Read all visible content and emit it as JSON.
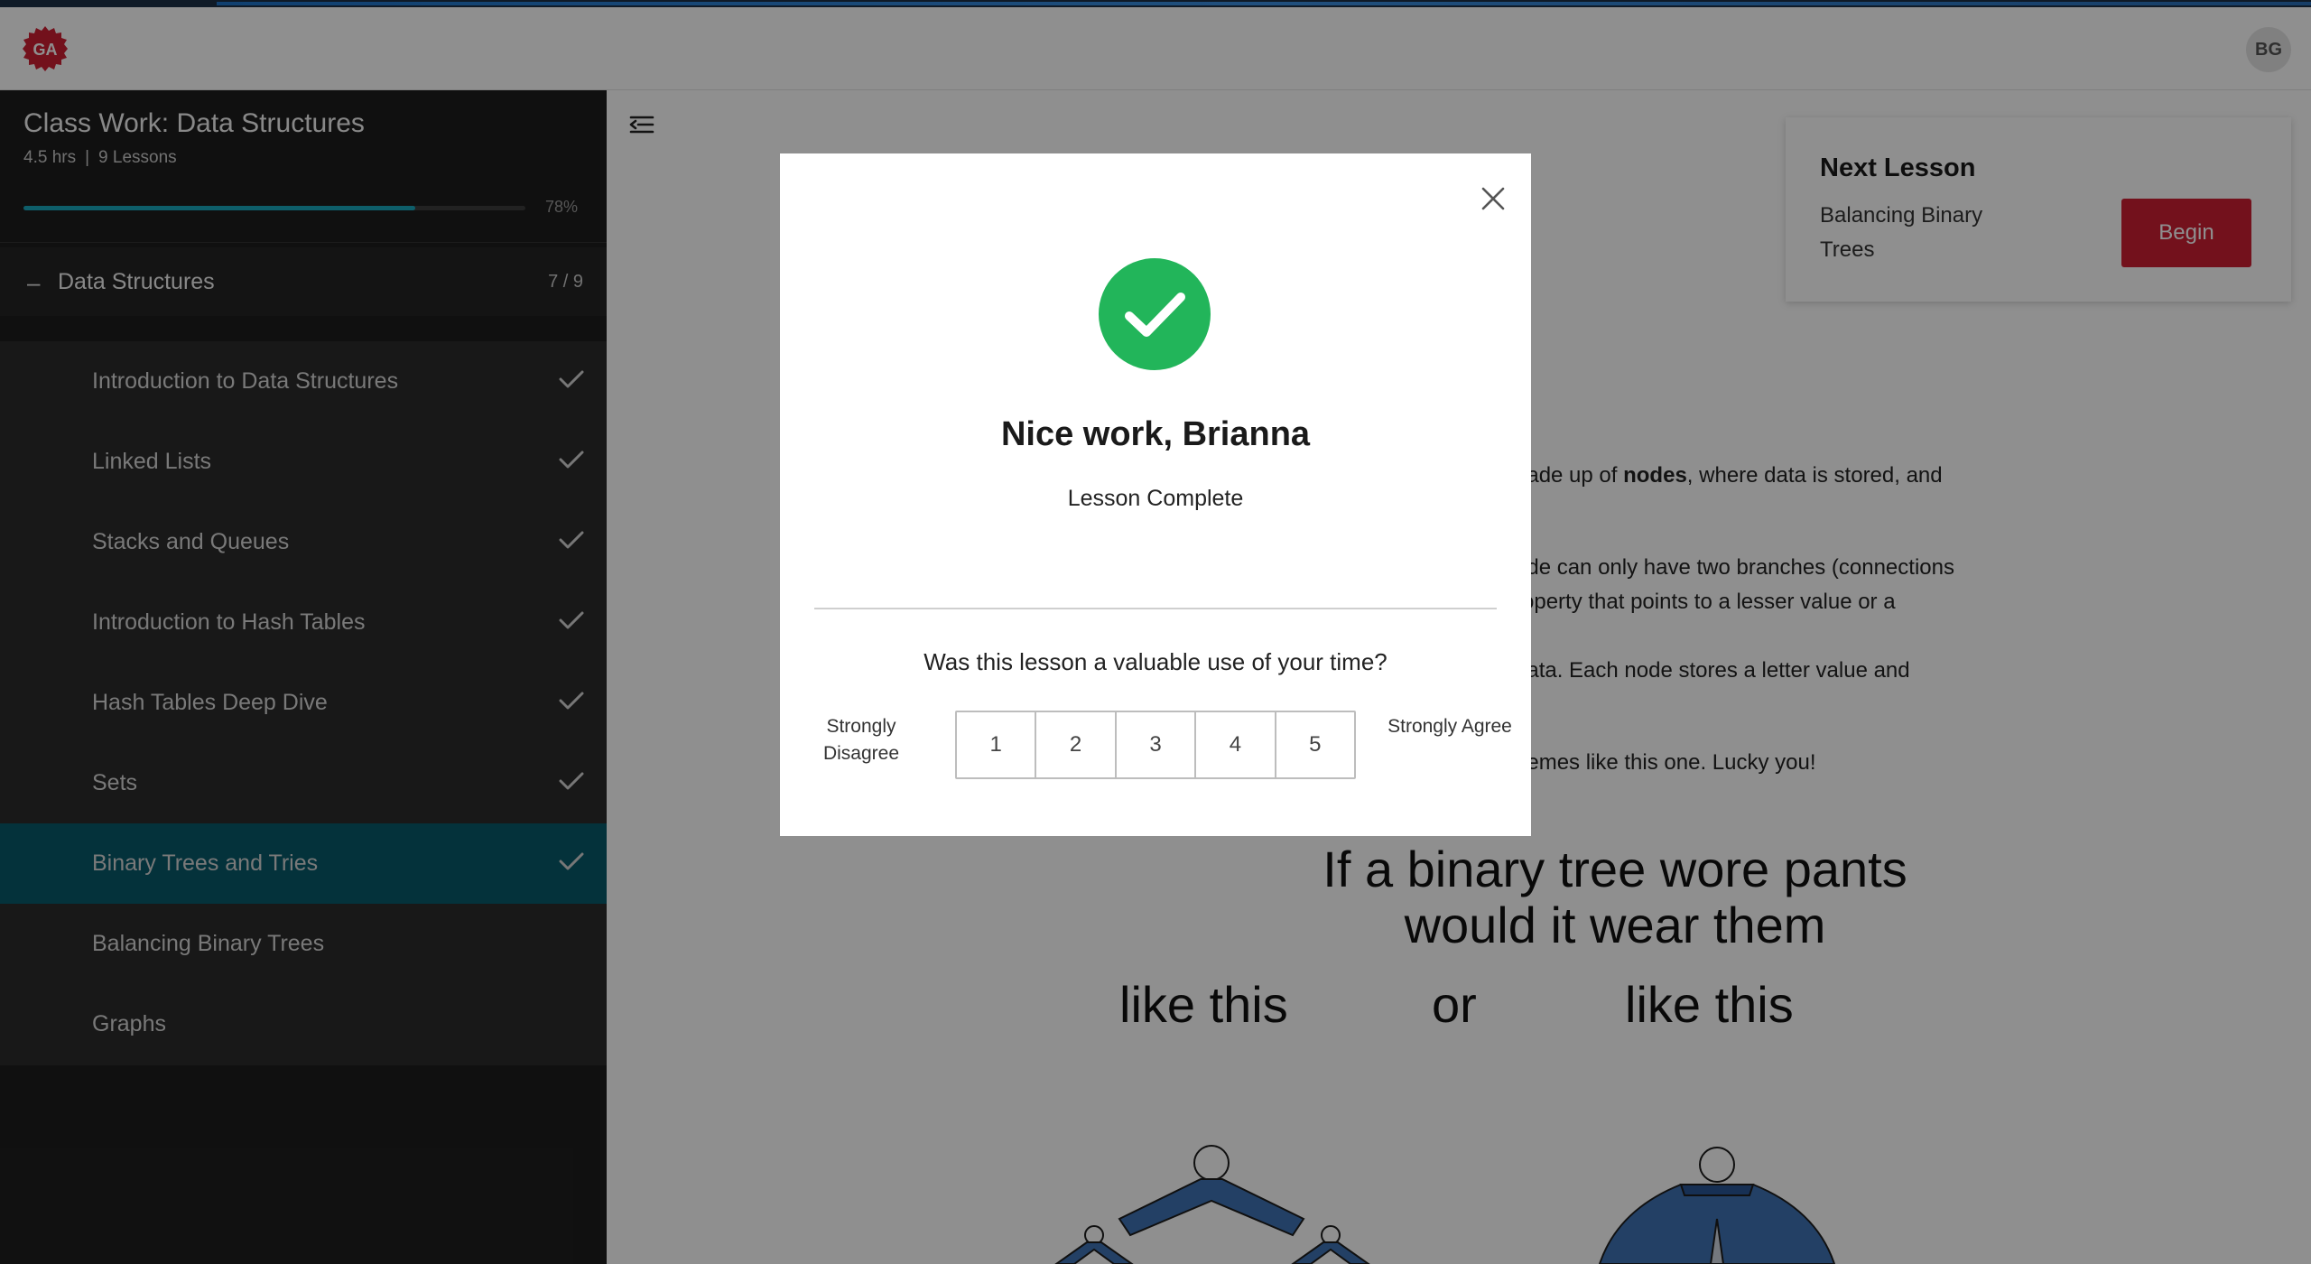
{
  "header": {
    "logo_text": "GA",
    "avatar_initials": "BG"
  },
  "sidebar": {
    "course_title": "Class Work: Data Structures",
    "duration": "4.5 hrs",
    "separator": "|",
    "lesson_count": "9 Lessons",
    "progress_percent_label": "78%",
    "progress_fraction": 0.78,
    "section_toggle": "–",
    "section_title": "Data Structures",
    "section_progress": "7 / 9",
    "lessons": [
      {
        "label": "Introduction to Data Structures",
        "completed": true
      },
      {
        "label": "Linked Lists",
        "completed": true
      },
      {
        "label": "Stacks and Queues",
        "completed": true
      },
      {
        "label": "Introduction to Hash Tables",
        "completed": true
      },
      {
        "label": "Hash Tables Deep Dive",
        "completed": true
      },
      {
        "label": "Sets",
        "completed": true
      },
      {
        "label": "Binary Trees and Tries",
        "completed": true,
        "active": true
      },
      {
        "label": "Balancing Binary Trees",
        "completed": false
      },
      {
        "label": "Graphs",
        "completed": false
      }
    ]
  },
  "next_lesson": {
    "heading": "Next Lesson",
    "name": "Balancing Binary Trees",
    "button_label": "Begin"
  },
  "article": {
    "line1_a": "nade up of ",
    "line1_bold": "nodes",
    "line1_b": ", where data is stored, and",
    "line2": "ode can only have two branches (connections",
    "line3": "roperty that points to a lesser value or a",
    "line4": " data. Each node stores a letter value and",
    "line5": "nemes like this one. Lucky you!"
  },
  "meme": {
    "line1": "If a binary tree wore pants",
    "line2": "would it wear them",
    "left_caption": "like this",
    "middle_caption": "or",
    "right_caption": "like this"
  },
  "modal": {
    "title": "Nice work, Brianna",
    "subtitle": "Lesson Complete",
    "question": "Was this lesson a valuable use of your time?",
    "scale_low": "Strongly Disagree",
    "scale_high": "Strongly Agree",
    "ratings": [
      "1",
      "2",
      "3",
      "4",
      "5"
    ]
  },
  "colors": {
    "accent_teal": "#1aa8be",
    "active_lesson": "#08596a",
    "brand_red": "#cd1f33",
    "success_green": "#22b55a"
  }
}
